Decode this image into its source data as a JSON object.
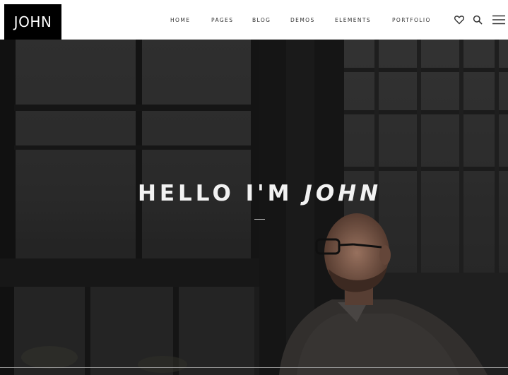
{
  "brand": {
    "logo_text": "JOHN"
  },
  "nav": {
    "items": [
      {
        "label": "HOME"
      },
      {
        "label": "PAGES"
      },
      {
        "label": "BLOG"
      },
      {
        "label": "DEMOS"
      },
      {
        "label": "ELEMENTS"
      },
      {
        "label": "PORTFOLIO"
      }
    ],
    "icons": [
      "heart-icon",
      "search-icon",
      "menu-icon"
    ]
  },
  "hero": {
    "title_prefix": "HELLO I'M ",
    "title_name": "JOHN"
  },
  "colors": {
    "header_bg": "#ffffff",
    "logo_bg": "#000000",
    "hero_text": "#f2f2f2"
  }
}
